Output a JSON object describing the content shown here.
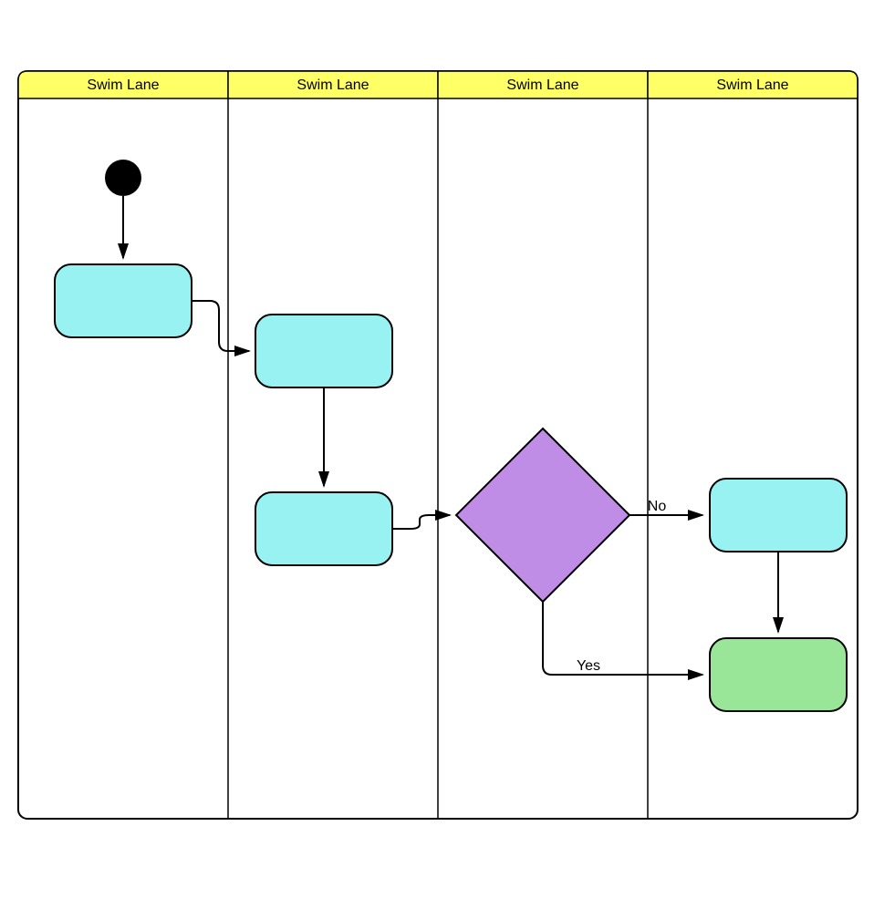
{
  "lanes": [
    {
      "label": "Swim Lane"
    },
    {
      "label": "Swim Lane"
    },
    {
      "label": "Swim Lane"
    },
    {
      "label": "Swim Lane"
    }
  ],
  "decision": {
    "yesLabel": "Yes",
    "noLabel": "No"
  },
  "colors": {
    "laneHeader": "#ffff66",
    "activity": "#99f2f2",
    "decision": "#bf8ce6",
    "terminal": "#99e699",
    "stroke": "#000000"
  }
}
